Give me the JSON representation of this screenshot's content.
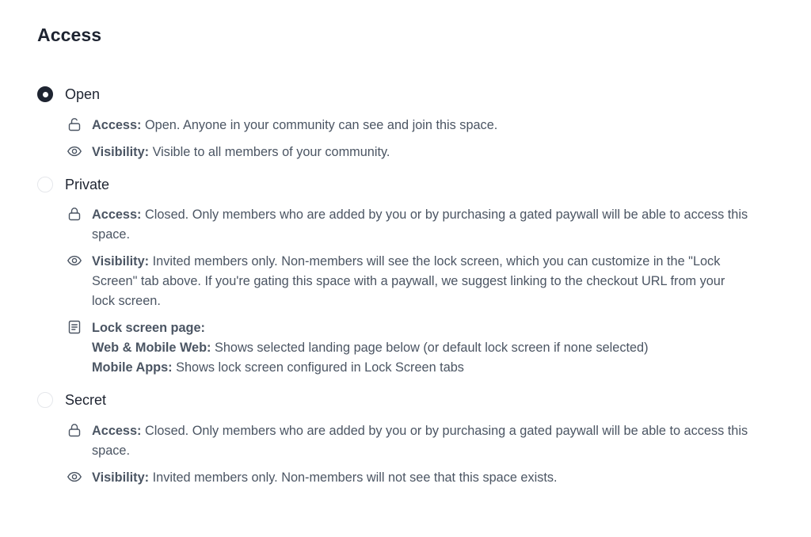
{
  "section": {
    "title": "Access"
  },
  "options": [
    {
      "label": "Open",
      "selected": true,
      "rows": [
        {
          "icon": "unlock-icon",
          "key": "Access:",
          "value": " Open. Anyone in your community can see and join this space."
        },
        {
          "icon": "eye-icon",
          "key": "Visibility:",
          "value": " Visible to all members of your community."
        }
      ]
    },
    {
      "label": "Private",
      "selected": false,
      "rows": [
        {
          "icon": "lock-icon",
          "key": "Access:",
          "value": " Closed. Only members who are added by you or by purchasing a gated paywall will be able to access this space."
        },
        {
          "icon": "eye-icon",
          "key": "Visibility:",
          "value": " Invited members only. Non-members will see the lock screen, which you can customize in the \"Lock Screen\" tab above. If you're gating this space with a paywall, we suggest linking to the checkout URL from your lock screen."
        },
        {
          "icon": "document-icon",
          "key": "Lock screen page:",
          "lines": [
            {
              "key": "Web & Mobile Web:",
              "value": " Shows selected landing page below (or default lock screen if none selected)"
            },
            {
              "key": "Mobile Apps:",
              "value": " Shows lock screen configured in Lock Screen tabs"
            }
          ]
        }
      ]
    },
    {
      "label": "Secret",
      "selected": false,
      "rows": [
        {
          "icon": "lock-icon",
          "key": "Access:",
          "value": " Closed. Only members who are added by you or by purchasing a gated paywall will be able to access this space."
        },
        {
          "icon": "eye-icon",
          "key": "Visibility:",
          "value": " Invited members only. Non-members will not see that this space exists."
        }
      ]
    }
  ]
}
